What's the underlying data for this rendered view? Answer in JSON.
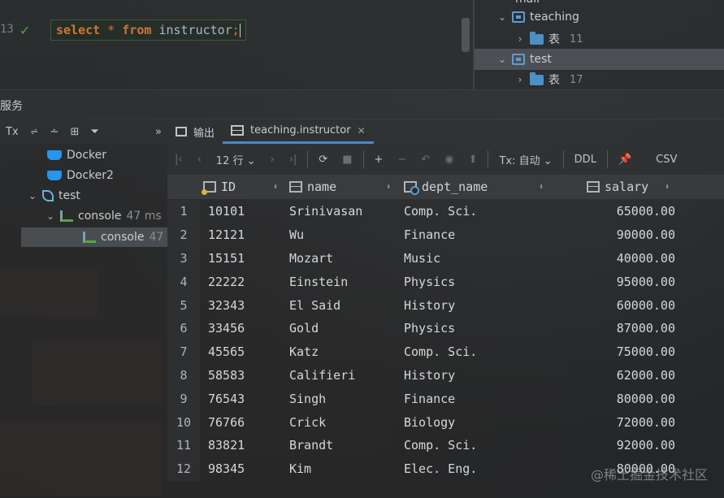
{
  "editor": {
    "line_number": "13",
    "sql": {
      "kw_select": "select",
      "star": "*",
      "kw_from": "from",
      "table": "instructor",
      "semicolon": ";"
    }
  },
  "db_tree": {
    "items": [
      {
        "label": "mall",
        "indent": 1
      },
      {
        "label": "teaching",
        "expanded": true
      },
      {
        "label": "表",
        "count": "11"
      },
      {
        "label": "test",
        "expanded": true,
        "selected": true
      },
      {
        "label": "表",
        "count": "17"
      }
    ]
  },
  "services": {
    "title": "服务",
    "toolbar": [
      "Tx",
      "⩫",
      "⩪",
      "⊞",
      "⏷"
    ],
    "tree": [
      {
        "label": "Docker",
        "icon": "docker-icon"
      },
      {
        "label": "Docker2",
        "icon": "docker-icon"
      },
      {
        "label": "test",
        "icon": "db-icon"
      },
      {
        "label": "console",
        "suffix": "47 ms",
        "icon": "console-icon"
      },
      {
        "label": "console",
        "suffix": "47",
        "icon": "console-icon"
      }
    ]
  },
  "results": {
    "tabs": [
      {
        "label": "输出"
      },
      {
        "label": "teaching.instructor"
      }
    ],
    "toolbar": {
      "rows_label": "12 行",
      "tx_label": "Tx: 自动",
      "ddl_label": "DDL",
      "csv_label": "CSV"
    },
    "columns": [
      "ID",
      "name",
      "dept_name",
      "salary"
    ],
    "rows": [
      [
        "1",
        "10101",
        "Srinivasan",
        "Comp. Sci.",
        "65000.00"
      ],
      [
        "2",
        "12121",
        "Wu",
        "Finance",
        "90000.00"
      ],
      [
        "3",
        "15151",
        "Mozart",
        "Music",
        "40000.00"
      ],
      [
        "4",
        "22222",
        "Einstein",
        "Physics",
        "95000.00"
      ],
      [
        "5",
        "32343",
        "El Said",
        "History",
        "60000.00"
      ],
      [
        "6",
        "33456",
        "Gold",
        "Physics",
        "87000.00"
      ],
      [
        "7",
        "45565",
        "Katz",
        "Comp. Sci.",
        "75000.00"
      ],
      [
        "8",
        "58583",
        "Califieri",
        "History",
        "62000.00"
      ],
      [
        "9",
        "76543",
        "Singh",
        "Finance",
        "80000.00"
      ],
      [
        "10",
        "76766",
        "Crick",
        "Biology",
        "72000.00"
      ],
      [
        "11",
        "83821",
        "Brandt",
        "Comp. Sci.",
        "92000.00"
      ],
      [
        "12",
        "98345",
        "Kim",
        "Elec. Eng.",
        "80000.00"
      ]
    ]
  },
  "watermark": "@稀土掘金技术社区"
}
